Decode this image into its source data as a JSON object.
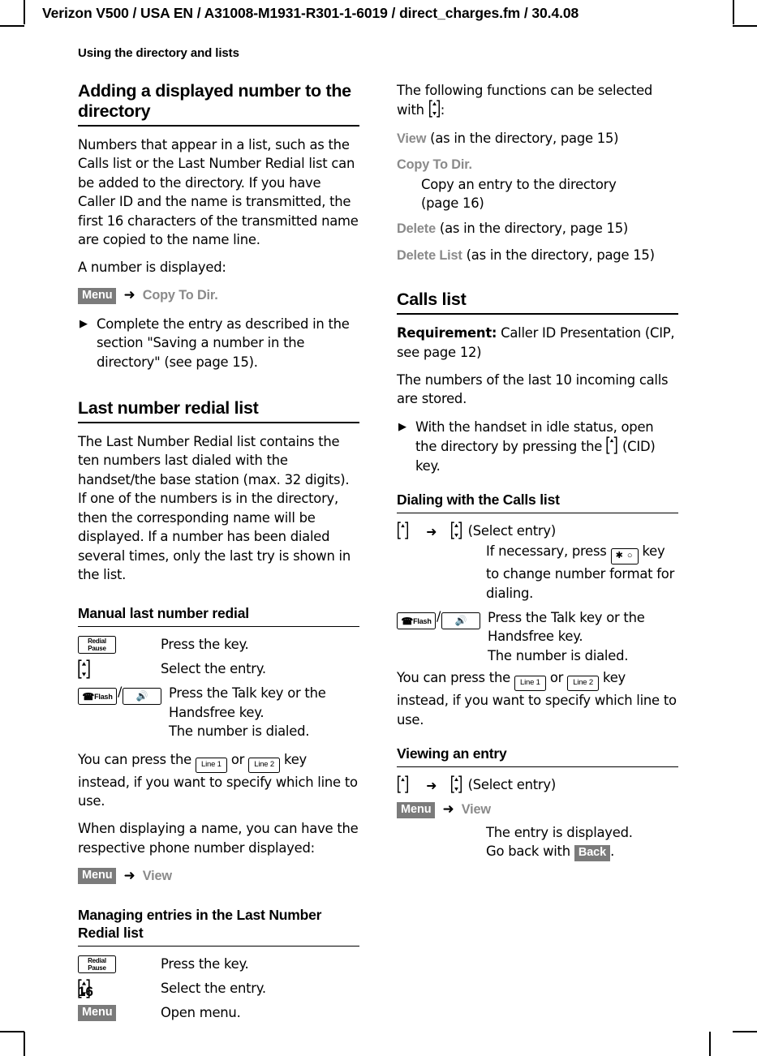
{
  "header": {
    "running_head": "Verizon V500 / USA EN / A31008-M1931-R301-1-6019 / direct_charges.fm / 30.4.08"
  },
  "chapter": {
    "title": "Using the directory and lists"
  },
  "folio": {
    "page_number": "16"
  },
  "colors": {
    "softkey_background": "#7b7b7b",
    "softkey_text": "#ffffff",
    "option_name_gray": "#8a8a8a",
    "body_text": "#000000"
  },
  "left_column": {
    "section1": {
      "heading": "Adding a displayed number to the directory",
      "paragraph1": "Numbers that appear in a list, such as the Calls list or the Last Number Redial list can be added to the directory. If you have Caller ID and the name is transmitted, the first 16 characters of the transmitted name are copied to the name line.",
      "paragraph2": "A number is displayed:",
      "menu_path": {
        "softkey": "Menu",
        "arrow": "➜",
        "option": "Copy To Dir."
      },
      "bullet1": "Complete the entry as described in the section \"Saving a number in the directory\" (see page 15)."
    },
    "section2": {
      "heading": "Last number redial list",
      "paragraph1": "The Last Number Redial list contains the ten numbers last dialed with the handset/the base station (max. 32 digits). If one of the numbers is in the directory, then the corresponding name will be displayed. If a number has been dialed several times, only the last try is shown in the list."
    },
    "section3": {
      "heading": "Manual last number redial",
      "steps": [
        {
          "icon": "redial-pause-key",
          "icon_label_line1": "Redial",
          "icon_label_line2": "Pause",
          "description": "Press the key."
        },
        {
          "icon": "control-key-updown",
          "description": "Select the entry."
        },
        {
          "icon": "talk-key-and-handsfree-key",
          "icon_label": "Flash",
          "description": "Press the Talk key or the Handsfree key.\nThe number is dialed."
        }
      ],
      "note_line1_pre": "You can press the ",
      "note_key1": "Line 1",
      "note_mid": " or ",
      "note_key2": "Line 2",
      "note_line1_post": " key instead, if you want to specify which line to use.",
      "paragraph2": "When displaying a name, you can have the respective phone number displayed:",
      "menu_path": {
        "softkey": "Menu",
        "arrow": "➜",
        "option": "View"
      }
    },
    "section4": {
      "heading": "Managing entries in the Last Number Redial list",
      "steps": [
        {
          "icon": "redial-pause-key",
          "icon_label_line1": "Redial",
          "icon_label_line2": "Pause",
          "description": "Press the key."
        },
        {
          "icon": "control-key-updown",
          "description": "Select the entry."
        },
        {
          "icon": "menu-softkey",
          "icon_label": "Menu",
          "description": "Open menu."
        }
      ]
    }
  },
  "right_column": {
    "intro": {
      "line_pre": "The following functions can be selected with ",
      "line_post": ":"
    },
    "options": [
      {
        "name": "View",
        "rest": " (as in the directory, page 15)"
      },
      {
        "name": "Copy To Dir.",
        "rest": "",
        "indent_lines": [
          "Copy an entry to the directory",
          "(page 16)"
        ]
      },
      {
        "name": "Delete",
        "rest": " (as in the directory, page 15)"
      },
      {
        "name": "Delete List",
        "rest": " (as in the directory, page 15)"
      }
    ],
    "section_calls": {
      "heading": "Calls list",
      "requirement_label": "Requirement:",
      "requirement_text": " Caller ID Presentation (CIP, see page 12)",
      "paragraph1": "The numbers of the last 10 incoming calls are stored.",
      "bullet_pre": "With the handset in idle status, open the directory by pressing the ",
      "bullet_post": " (CID) key."
    },
    "section_dialing": {
      "heading": "Dialing with the Calls list",
      "first_row_arrow": "➜",
      "first_row_label": "(Select entry)",
      "sub_line_pre": "If necessary, press ",
      "sub_key": "✱ ○",
      "sub_line_post": " key to change number format for dialing.",
      "step_talk": {
        "icon_label": "Flash",
        "description": "Press the Talk key or the Handsfree key.\nThe number is dialed."
      },
      "note_pre": "You can press the ",
      "note_key1": "Line 1",
      "note_mid": " or ",
      "note_key2": "Line 2",
      "note_post": " key instead, if you want to specify which line to use."
    },
    "section_viewing": {
      "heading": "Viewing an entry",
      "first_row_arrow": "➜",
      "first_row_label": "(Select entry)",
      "menu_path": {
        "softkey": "Menu",
        "arrow": "➜",
        "option": "View"
      },
      "result_line1": "The entry is displayed.",
      "result_line2_pre": "Go back with ",
      "result_softkey": "Back",
      "result_line2_post": "."
    }
  }
}
